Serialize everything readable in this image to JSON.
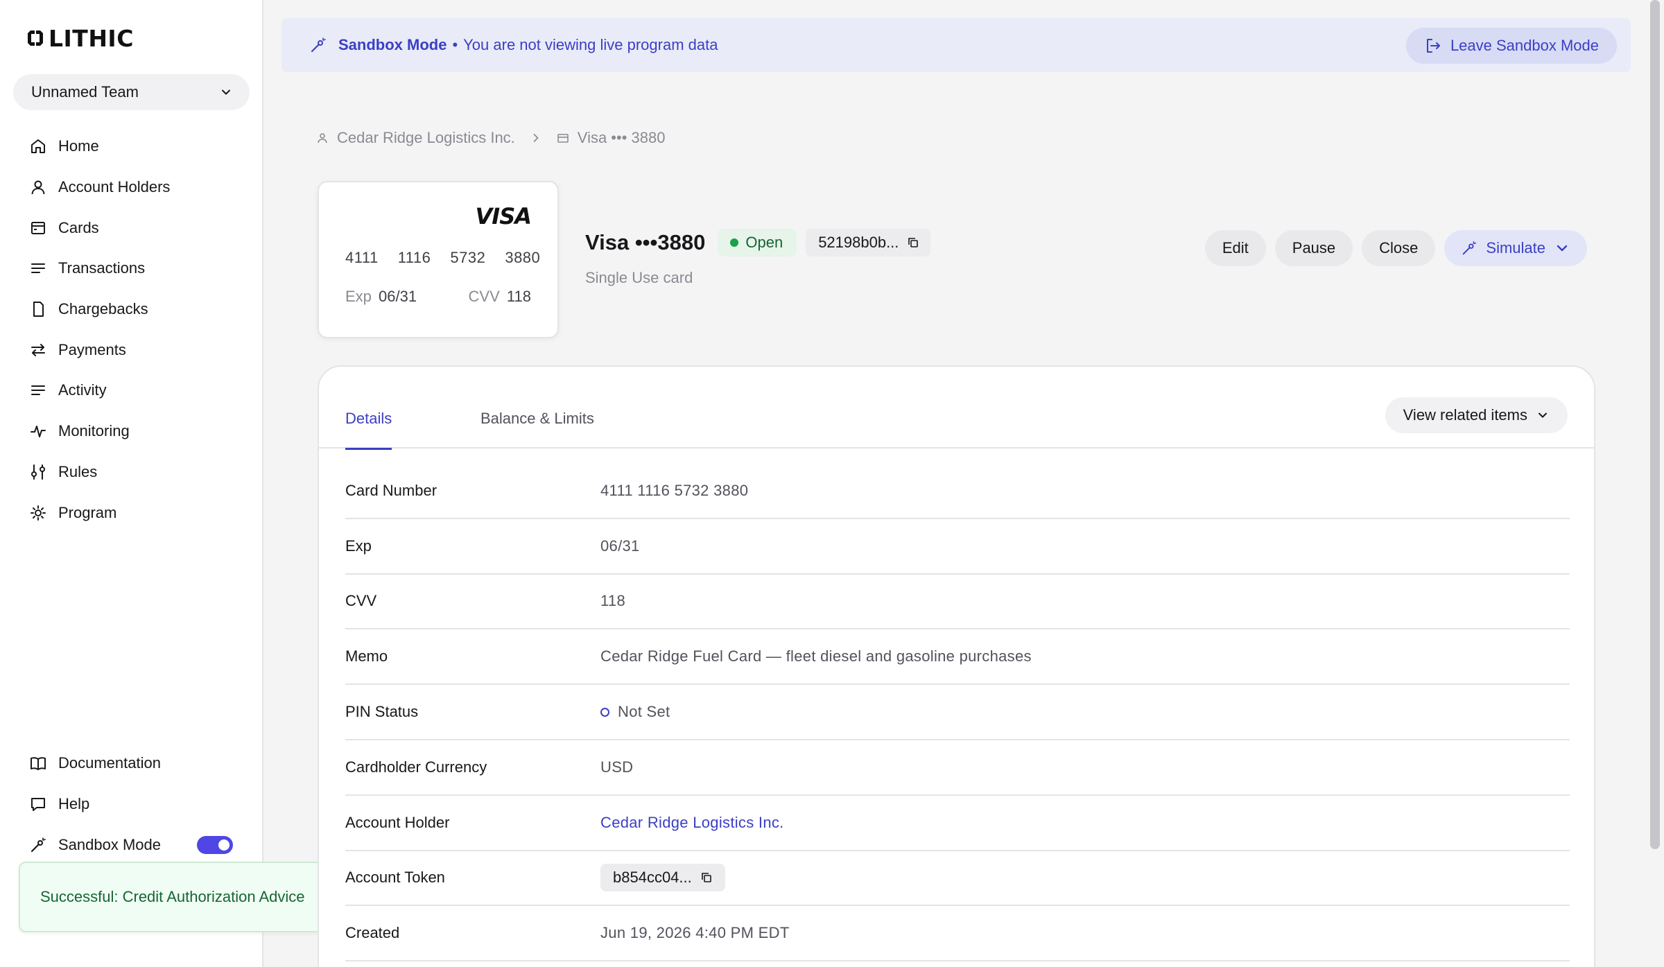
{
  "app": {
    "brand": "LITHIC"
  },
  "team": {
    "name": "Unnamed Team"
  },
  "sidebar": {
    "items": [
      {
        "label": "Home",
        "icon": "home-icon"
      },
      {
        "label": "Account Holders",
        "icon": "user-icon"
      },
      {
        "label": "Cards",
        "icon": "card-icon"
      },
      {
        "label": "Transactions",
        "icon": "list-icon"
      },
      {
        "label": "Chargebacks",
        "icon": "document-icon"
      },
      {
        "label": "Payments",
        "icon": "arrows-icon"
      },
      {
        "label": "Activity",
        "icon": "list-icon"
      },
      {
        "label": "Monitoring",
        "icon": "pulse-icon"
      },
      {
        "label": "Rules",
        "icon": "sliders-icon"
      },
      {
        "label": "Program",
        "icon": "gear-icon"
      }
    ],
    "bottom": [
      {
        "label": "Documentation",
        "icon": "book-icon"
      },
      {
        "label": "Help",
        "icon": "chat-icon"
      },
      {
        "label": "Sandbox Mode",
        "icon": "wand-icon",
        "toggle_on": true
      }
    ]
  },
  "toast": {
    "message": "Successful: Credit Authorization Advice"
  },
  "banner": {
    "mode": "Sandbox Mode",
    "separator": "•",
    "message": "You are not viewing live program data",
    "leave_label": "Leave Sandbox Mode"
  },
  "breadcrumb": {
    "holder": "Cedar Ridge Logistics Inc.",
    "card": "Visa ••• 3880"
  },
  "card_visual": {
    "brand": "VISA",
    "number_groups": [
      "4111",
      "1116",
      "5732",
      "3880"
    ],
    "exp_label": "Exp",
    "exp": "06/31",
    "cvv_label": "CVV",
    "cvv": "118"
  },
  "card_header": {
    "title": "Visa •••3880",
    "status": "Open",
    "token": "52198b0b...",
    "subtitle": "Single Use card"
  },
  "actions": {
    "edit": "Edit",
    "pause": "Pause",
    "close": "Close",
    "simulate": "Simulate"
  },
  "tabs": {
    "details": "Details",
    "balance": "Balance & Limits",
    "related": "View related items"
  },
  "details": {
    "card_number": {
      "label": "Card Number",
      "value": "4111 1116 5732 3880"
    },
    "exp": {
      "label": "Exp",
      "value": "06/31"
    },
    "cvv": {
      "label": "CVV",
      "value": "118"
    },
    "memo": {
      "label": "Memo",
      "value": "Cedar Ridge Fuel Card — fleet diesel and gasoline purchases"
    },
    "pin": {
      "label": "PIN Status",
      "value": "Not Set"
    },
    "currency": {
      "label": "Cardholder Currency",
      "value": "USD"
    },
    "holder": {
      "label": "Account Holder",
      "value": "Cedar Ridge Logistics Inc."
    },
    "token": {
      "label": "Account Token",
      "value": "b854cc04..."
    },
    "created": {
      "label": "Created",
      "value": "Jun 19, 2026 4:40 PM EDT"
    }
  }
}
